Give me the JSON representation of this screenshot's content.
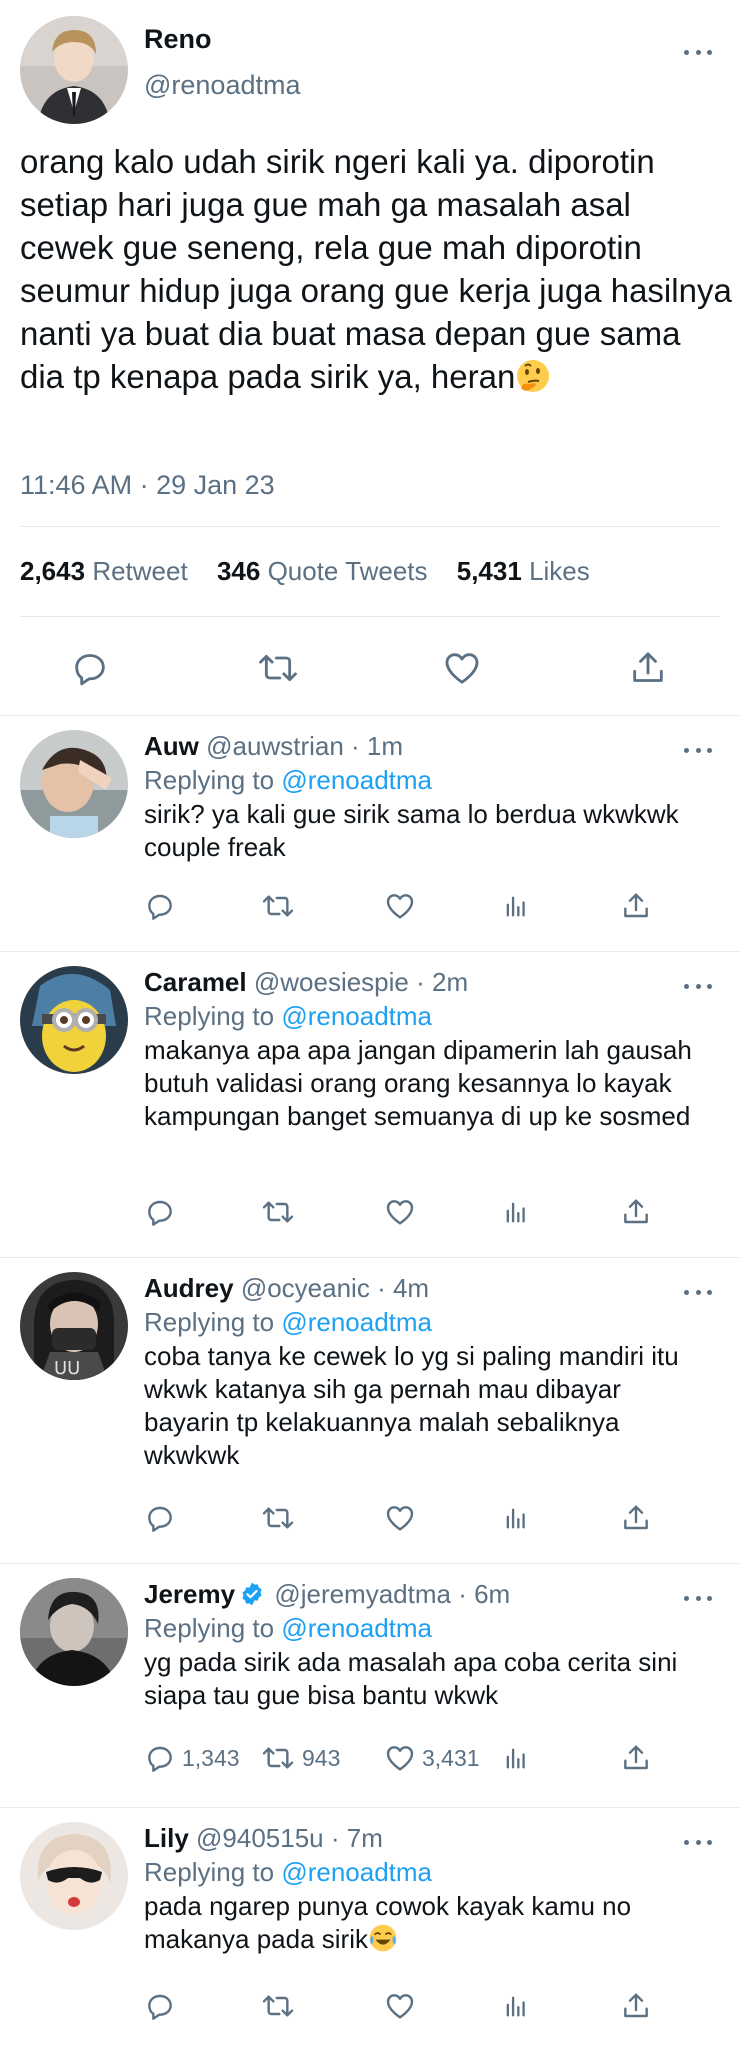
{
  "main_tweet": {
    "author_name": "Reno",
    "author_handle": "@renoadtma",
    "text": "orang kalo udah sirik ngeri kali ya. diporotin setiap hari juga gue mah ga masalah asal cewek gue seneng, rela gue mah diporotin seumur hidup juga orang gue kerja juga hasilnya nanti ya buat dia buat masa depan gue sama dia tp kenapa pada sirik ya, heran",
    "emoji": "thinking-face-emoji",
    "timestamp": "11:46 AM · 29 Jan 23",
    "stats": {
      "retweets_count": "2,643",
      "retweets_label": "Retweet",
      "quotes_count": "346",
      "quotes_label": "Quote Tweets",
      "likes_count": "5,431",
      "likes_label": "Likes"
    }
  },
  "replies": [
    {
      "name": "Auw",
      "handle": "@auwstrian",
      "time": "· 1m",
      "replying_prefix": "Replying to",
      "replying_to": "@renoadtma",
      "text": "sirik? ya kali gue sirik sama lo berdua wkwkwk couple freak",
      "verified": false,
      "counts": {
        "reply": "",
        "retweet": "",
        "like": ""
      }
    },
    {
      "name": "Caramel",
      "handle": "@woesiespie",
      "time": "· 2m",
      "replying_prefix": "Replying to",
      "replying_to": "@renoadtma",
      "text": "makanya apa apa jangan dipamerin lah gausah butuh validasi orang orang kesannya lo kayak kampungan banget semuanya di up ke sosmed",
      "verified": false,
      "counts": {
        "reply": "",
        "retweet": "",
        "like": ""
      }
    },
    {
      "name": "Audrey",
      "handle": "@ocyeanic",
      "time": "· 4m",
      "replying_prefix": "Replying to",
      "replying_to": "@renoadtma",
      "text": "coba tanya ke cewek lo yg si paling mandiri itu wkwk katanya sih ga pernah mau dibayar bayarin tp kelakuannya malah sebaliknya wkwkwk",
      "verified": false,
      "counts": {
        "reply": "",
        "retweet": "",
        "like": ""
      }
    },
    {
      "name": "Jeremy",
      "handle": "@jeremyadtma",
      "time": "· 6m",
      "replying_prefix": "Replying to",
      "replying_to": "@renoadtma",
      "text": "yg pada sirik ada masalah apa coba cerita sini siapa tau gue bisa bantu wkwk",
      "verified": true,
      "counts": {
        "reply": "1,343",
        "retweet": "943",
        "like": "3,431"
      }
    },
    {
      "name": "Lily",
      "handle": "@940515u",
      "time": "· 7m",
      "replying_prefix": "Replying to",
      "replying_to": "@renoadtma",
      "text": "pada ngarep punya cowok kayak kamu no makanya pada sirik",
      "verified": false,
      "emoji": "tears-of-joy-emoji",
      "counts": {
        "reply": "",
        "retweet": "",
        "like": ""
      }
    }
  ],
  "colors": {
    "text": "#0f1419",
    "secondary": "#5b7083",
    "link": "#1da1f2",
    "divider": "#e6ecf0"
  }
}
